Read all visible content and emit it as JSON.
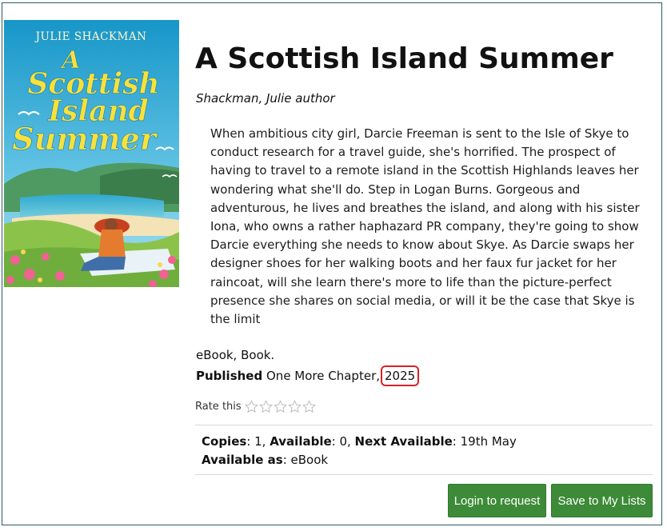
{
  "cover": {
    "author_text": "JULIE SHACKMAN",
    "title_line1": "A",
    "title_line2": "Scottish",
    "title_line3": "Island",
    "title_line4": "Summer"
  },
  "book": {
    "title": "A Scottish Island Summer",
    "author": "Shackman, Julie author",
    "summary": "When ambitious city girl, Darcie Freeman is sent to the Isle of Skye to conduct research for a travel guide, she's horrified. The prospect of having to travel to a remote island in the Scottish Highlands leaves her wondering what she'll do. Step in Logan Burns. Gorgeous and adventurous, he lives and breathes the island, and along with his sister Iona, who owns a rather haphazard PR company, they're going to show Darcie everything she needs to know about Skye. As Darcie swaps her designer shoes for her walking boots and her faux fur jacket for her raincoat, will she learn there's more to life than the picture-perfect presence she shares on social media, or will it be the case that Skye is the limit",
    "format": "eBook, Book.",
    "published_label": "Published",
    "publisher": "One More Chapter,",
    "year": "2025"
  },
  "rating": {
    "label": "Rate this",
    "max_stars": 5,
    "current": 0
  },
  "availability": {
    "copies_label": "Copies",
    "copies_value": ": 1, ",
    "available_label": "Available",
    "available_value": ": 0, ",
    "next_label": "Next Available",
    "next_value": ": 19th May",
    "available_as_label": "Available as",
    "available_as_value": ": eBook"
  },
  "actions": {
    "login_label": "Login to request",
    "save_label": "Save to My Lists"
  },
  "colors": {
    "button_green": "#3d8b38",
    "highlight_red": "#d8202a",
    "frame_border": "#2c5a66"
  }
}
